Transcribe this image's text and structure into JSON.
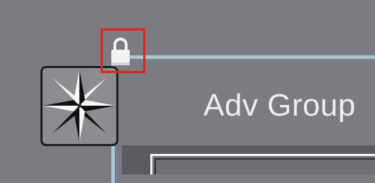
{
  "group": {
    "title": "Adv Group"
  },
  "icons": {
    "compass": "compass-icon",
    "lock": "lock-icon"
  },
  "colors": {
    "background": "#7c7b81",
    "frame": "#a9c6d6",
    "highlight": "#e0231c",
    "title_text": "#eeeeee"
  }
}
